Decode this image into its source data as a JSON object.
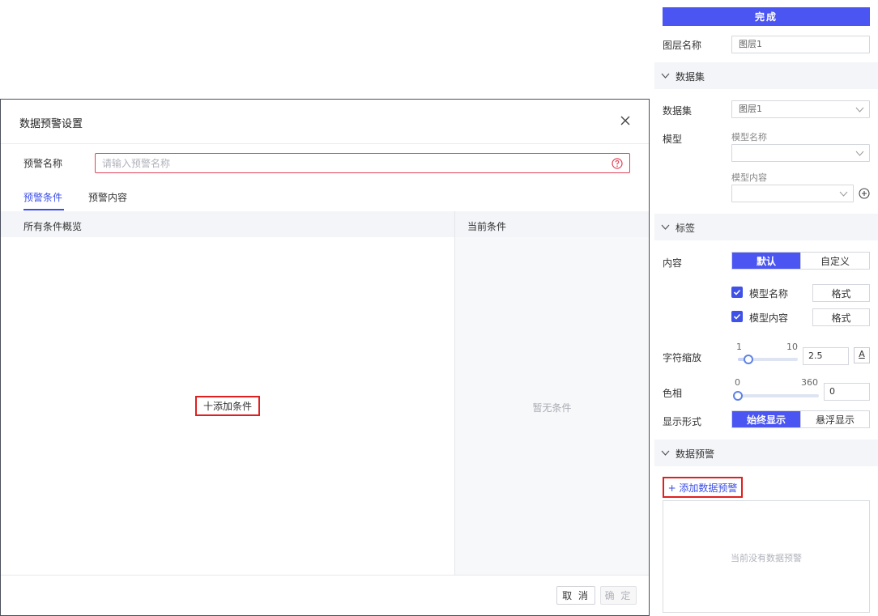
{
  "dialog": {
    "title": "数据预警设置",
    "name_label": "预警名称",
    "name_placeholder": "请输入预警名称",
    "tabs": [
      {
        "label": "预警条件",
        "active": true
      },
      {
        "label": "预警内容",
        "active": false
      }
    ],
    "overview_header": "所有条件概览",
    "current_header": "当前条件",
    "add_condition": "十添加条件",
    "empty_condition": "暂无条件",
    "cancel_label": "取 消",
    "ok_label": "确 定"
  },
  "panel": {
    "done_label": "完成",
    "layer_name_label": "图层名称",
    "layer_name_value": "图层1",
    "dataset_section": {
      "title": "数据集",
      "dataset_label": "数据集",
      "dataset_value": "图层1",
      "model_label": "模型",
      "model_name_label": "模型名称",
      "model_name_value": "",
      "model_content_label": "模型内容",
      "model_content_value": ""
    },
    "label_section": {
      "title": "标签",
      "content_label": "内容",
      "content_options": [
        "默认",
        "自定义"
      ],
      "content_selected": "默认",
      "items": [
        {
          "label": "模型名称",
          "checked": true,
          "format_label": "格式"
        },
        {
          "label": "模型内容",
          "checked": true,
          "format_label": "格式"
        }
      ],
      "scale_label": "字符缩放",
      "scale_min": "1",
      "scale_max": "10",
      "scale_value": "2.5",
      "scale_position": 0.17,
      "font_button": "A",
      "hue_label": "色相",
      "hue_min": "0",
      "hue_max": "360",
      "hue_value": "0",
      "hue_position": 0,
      "display_label": "显示形式",
      "display_options": [
        "始终显示",
        "悬浮显示"
      ],
      "display_selected": "始终显示"
    },
    "warning_section": {
      "title": "数据预警",
      "add_label": "+ 添加数据预警",
      "empty_text": "当前没有数据预警"
    }
  },
  "colors": {
    "primary": "#4a55f2",
    "tab_active": "#3a4ee6",
    "highlight_border": "#e02020",
    "input_error_border": "#e0435a"
  }
}
